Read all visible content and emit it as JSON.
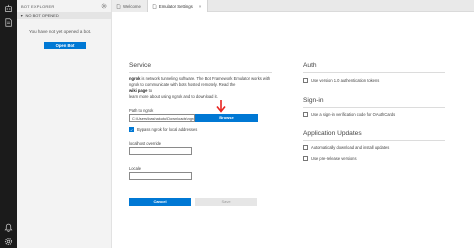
{
  "activity_bar": {
    "top_icons": [
      "robot-icon",
      "document-icon"
    ],
    "bottom_icons": [
      "bell-icon",
      "gear-icon"
    ]
  },
  "explorer": {
    "title": "BOT EXPLORER",
    "section": "NO BOT OPENED",
    "empty_text": "You have not yet opened a bot.",
    "open_bot_label": "Open Bot"
  },
  "tabs": [
    {
      "label": "Welcome",
      "active": false
    },
    {
      "label": "Emulator Settings",
      "active": true
    }
  ],
  "settings": {
    "service": {
      "title": "Service",
      "description": [
        {
          "bold": "ngrok",
          "text": " is network tunneling software. The Bot Framework Emulator works with"
        },
        {
          "text": "ngrok to communicate with bots hosted remotely. Read the "
        },
        {
          "bold": "wiki page",
          "text": " to"
        },
        {
          "text": "learn more about using ngrok and to download it."
        }
      ],
      "path_label": "Path to ngrok",
      "path_value": "C:\\Users\\bashakutu\\Downloads\\ngrok-stable-windows-amd64\\ngrok.exe",
      "browse_label": "Browse",
      "bypass_label": "Bypass ngrok for local addresses",
      "bypass_checked": true,
      "localhost_label": "localhost override",
      "localhost_value": "",
      "locale_label": "Locale",
      "locale_value": ""
    },
    "auth": {
      "title": "Auth",
      "items": [
        {
          "label": "Use version 1.0 authentication tokens",
          "checked": false
        }
      ]
    },
    "signin": {
      "title": "Sign-in",
      "items": [
        {
          "label": "Use a sign-in verification code for OAuthCards",
          "checked": false
        }
      ]
    },
    "updates": {
      "title": "Application Updates",
      "items": [
        {
          "label": "Automatically download and install updates",
          "checked": false
        },
        {
          "label": "Use pre-release versions",
          "checked": false
        }
      ]
    },
    "cancel_label": "Cancel",
    "save_label": "Save"
  },
  "colors": {
    "accent": "#0078d4",
    "activity_bar": "#1b1b1b",
    "explorer_bg": "#f3f3f3",
    "annotation": "#e8231f"
  }
}
